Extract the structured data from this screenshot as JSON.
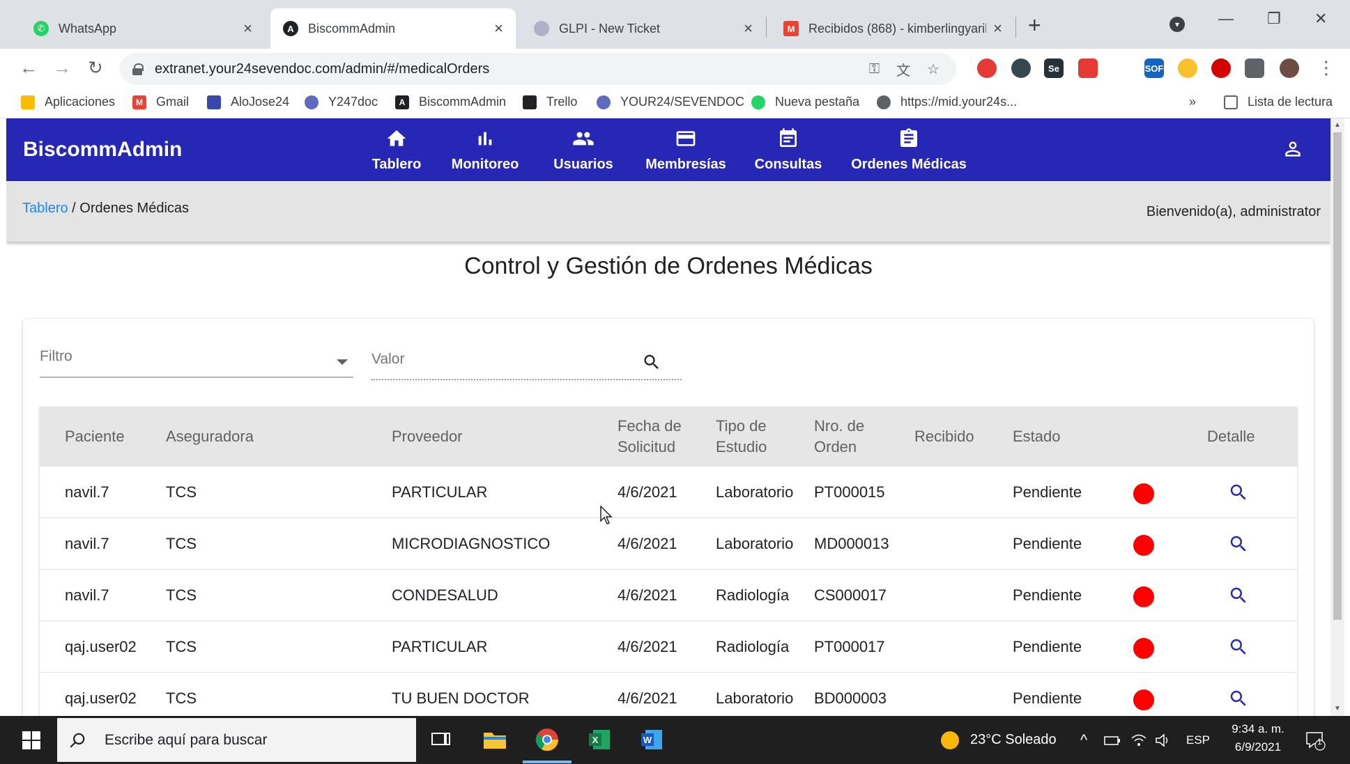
{
  "browser": {
    "tabs": [
      {
        "label": "WhatsApp",
        "active": false
      },
      {
        "label": "BiscommAdmin",
        "active": true
      },
      {
        "label": "GLPI - New Ticket",
        "active": false
      },
      {
        "label": "Recibidos (868) - kimberlingyarih",
        "active": false
      }
    ],
    "url": "extranet.your24sevendoc.com/admin/#/medicalOrders",
    "bookmarks": [
      "Aplicaciones",
      "Gmail",
      "AloJose24",
      "Y247doc",
      "BiscommAdmin",
      "Trello",
      "YOUR24/SEVENDOC",
      "Nueva pestaña",
      "https://mid.your24s..."
    ],
    "bookmarks_more": "»",
    "reading_list": "Lista de lectura",
    "extensions": [
      "ext-1",
      "ext-2",
      "Se",
      "ext-4",
      "ext-5",
      "SOF",
      "ext-7",
      "ext-8",
      "ext-9"
    ]
  },
  "app": {
    "brand": "BiscommAdmin",
    "nav": [
      {
        "label": "Tablero",
        "icon": "home-icon"
      },
      {
        "label": "Monitoreo",
        "icon": "bar-chart-icon"
      },
      {
        "label": "Usuarios",
        "icon": "people-icon"
      },
      {
        "label": "Membresías",
        "icon": "credit-card-icon"
      },
      {
        "label": "Consultas",
        "icon": "calendar-icon"
      },
      {
        "label": "Ordenes Médicas",
        "icon": "clipboard-icon"
      }
    ],
    "breadcrumb": {
      "root": "Tablero",
      "separator": " / ",
      "current": "Ordenes Médicas"
    },
    "welcome": "Bienvenido(a), administrator",
    "page_title": "Control y Gestión de Ordenes Médicas",
    "filter": {
      "label": "Filtro"
    },
    "value_field": {
      "placeholder": "Valor"
    },
    "table": {
      "columns": [
        "Paciente",
        "Aseguradora",
        "Proveedor",
        "Fecha de Solicitud",
        "Tipo de Estudio",
        "Nro. de Orden",
        "Recibido",
        "Estado",
        "Detalle"
      ],
      "rows": [
        {
          "paciente": "navil.7",
          "aseguradora": "TCS",
          "proveedor": "PARTICULAR",
          "fecha": "4/6/2021",
          "tipo": "Laboratorio",
          "orden": "PT000015",
          "recibido": "",
          "estado": "Pendiente"
        },
        {
          "paciente": "navil.7",
          "aseguradora": "TCS",
          "proveedor": "MICRODIAGNOSTICO",
          "fecha": "4/6/2021",
          "tipo": "Laboratorio",
          "orden": "MD000013",
          "recibido": "",
          "estado": "Pendiente"
        },
        {
          "paciente": "navil.7",
          "aseguradora": "TCS",
          "proveedor": "CONDESALUD",
          "fecha": "4/6/2021",
          "tipo": "Radiología",
          "orden": "CS000017",
          "recibido": "",
          "estado": "Pendiente"
        },
        {
          "paciente": "qaj.user02",
          "aseguradora": "TCS",
          "proveedor": "PARTICULAR",
          "fecha": "4/6/2021",
          "tipo": "Radiología",
          "orden": "PT000017",
          "recibido": "",
          "estado": "Pendiente"
        },
        {
          "paciente": "qaj.user02",
          "aseguradora": "TCS",
          "proveedor": "TU BUEN DOCTOR",
          "fecha": "4/6/2021",
          "tipo": "Laboratorio",
          "orden": "BD000003",
          "recibido": "",
          "estado": "Pendiente"
        }
      ]
    }
  },
  "taskbar": {
    "search_placeholder": "Escribe aquí para buscar",
    "weather": "23°C  Soleado",
    "language": "ESP",
    "time": "9:34 a. m.",
    "date": "6/9/2021",
    "notifications": "1",
    "apps": [
      "task-view",
      "file-explorer",
      "chrome",
      "excel",
      "word"
    ]
  },
  "colors": {
    "appbar": "#2727b5",
    "link": "#1e88e5",
    "status_pending": "#ff0000",
    "detail_icon": "#2727b5"
  }
}
